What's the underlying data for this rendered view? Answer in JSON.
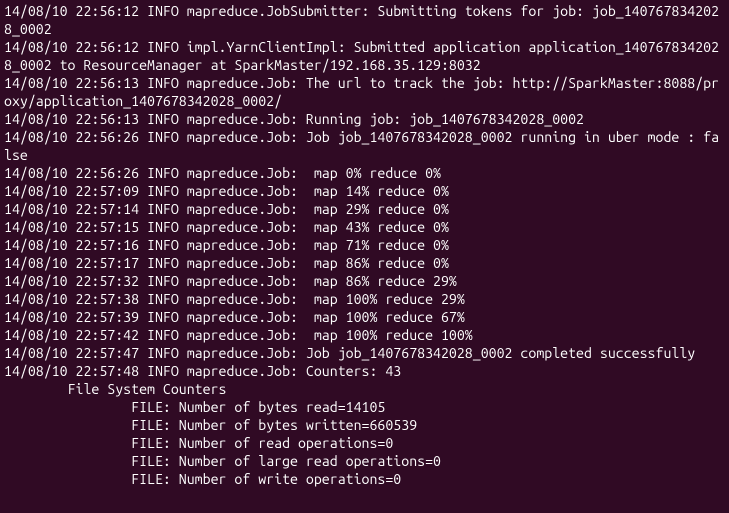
{
  "lines": [
    "14/08/10 22:56:12 INFO mapreduce.JobSubmitter: Submitting tokens for job: job_1407678342028_0002",
    "14/08/10 22:56:12 INFO impl.YarnClientImpl: Submitted application application_1407678342028_0002 to ResourceManager at SparkMaster/192.168.35.129:8032",
    "14/08/10 22:56:13 INFO mapreduce.Job: The url to track the job: http://SparkMaster:8088/proxy/application_1407678342028_0002/",
    "14/08/10 22:56:13 INFO mapreduce.Job: Running job: job_1407678342028_0002",
    "14/08/10 22:56:26 INFO mapreduce.Job: Job job_1407678342028_0002 running in uber mode : false",
    "14/08/10 22:56:26 INFO mapreduce.Job:  map 0% reduce 0%",
    "14/08/10 22:57:09 INFO mapreduce.Job:  map 14% reduce 0%",
    "14/08/10 22:57:14 INFO mapreduce.Job:  map 29% reduce 0%",
    "14/08/10 22:57:15 INFO mapreduce.Job:  map 43% reduce 0%",
    "14/08/10 22:57:16 INFO mapreduce.Job:  map 71% reduce 0%",
    "14/08/10 22:57:17 INFO mapreduce.Job:  map 86% reduce 0%",
    "14/08/10 22:57:32 INFO mapreduce.Job:  map 86% reduce 29%",
    "14/08/10 22:57:38 INFO mapreduce.Job:  map 100% reduce 29%",
    "14/08/10 22:57:39 INFO mapreduce.Job:  map 100% reduce 67%",
    "14/08/10 22:57:42 INFO mapreduce.Job:  map 100% reduce 100%",
    "14/08/10 22:57:47 INFO mapreduce.Job: Job job_1407678342028_0002 completed successfully",
    "14/08/10 22:57:48 INFO mapreduce.Job: Counters: 43",
    "        File System Counters",
    "                FILE: Number of bytes read=14105",
    "                FILE: Number of bytes written=660539",
    "                FILE: Number of read operations=0",
    "                FILE: Number of large read operations=0",
    "                FILE: Number of write operations=0"
  ]
}
